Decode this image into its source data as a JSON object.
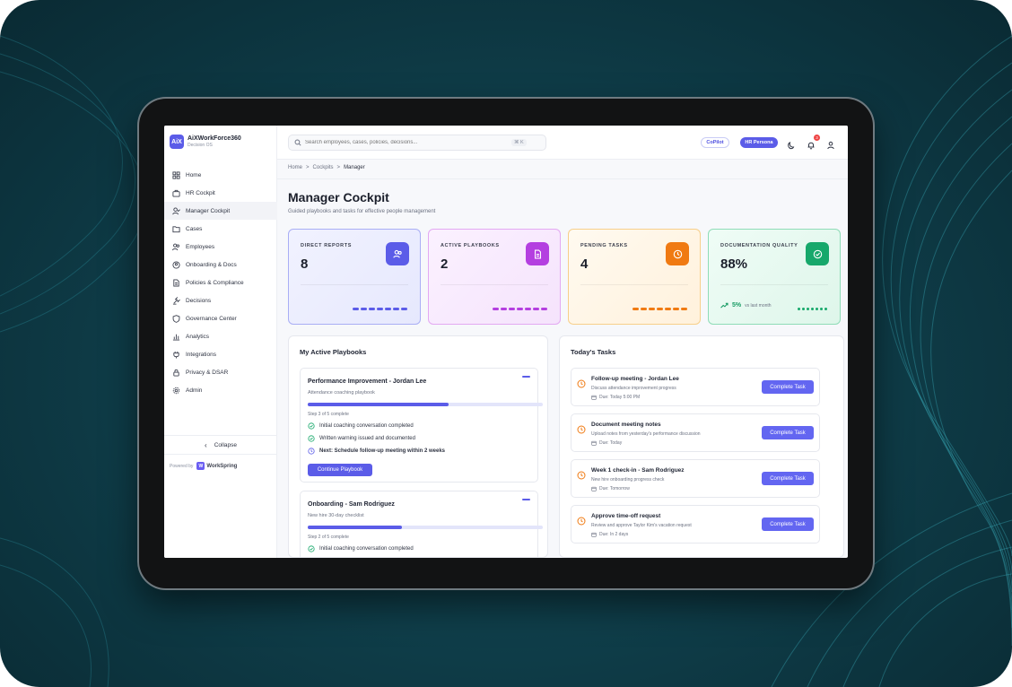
{
  "brand": {
    "logo": "AiX",
    "name": "AiXWorkForce360",
    "sub": "Decision OS"
  },
  "sidebar": {
    "items": [
      {
        "label": "Home",
        "icon": "home-icon"
      },
      {
        "label": "HR Cockpit",
        "icon": "briefcase-icon"
      },
      {
        "label": "Manager Cockpit",
        "icon": "user-check-icon",
        "active": true
      },
      {
        "label": "Cases",
        "icon": "folder-icon"
      },
      {
        "label": "Employees",
        "icon": "users-icon"
      },
      {
        "label": "Onboarding & Docs",
        "icon": "user-plus-icon"
      },
      {
        "label": "Policies & Compliance",
        "icon": "document-icon"
      },
      {
        "label": "Decisions",
        "icon": "gavel-icon"
      },
      {
        "label": "Governance Center",
        "icon": "shield-icon"
      },
      {
        "label": "Analytics",
        "icon": "bar-chart-icon"
      },
      {
        "label": "Integrations",
        "icon": "plug-icon"
      },
      {
        "label": "Privacy & DSAR",
        "icon": "lock-icon"
      },
      {
        "label": "Admin",
        "icon": "gear-icon"
      }
    ],
    "collapse_label": "Collapse",
    "powered_by": "Powered by",
    "powered_brand": "WorkSpring"
  },
  "header": {
    "search_placeholder": "Search employees, cases, policies, decisions...",
    "search_shortcut": "⌘ K",
    "copilot_label": "CoPilot",
    "persona_label": "HR Persona",
    "notification_count": "3"
  },
  "breadcrumb": [
    "Home",
    "Cockpits",
    "Manager"
  ],
  "page": {
    "title": "Manager Cockpit",
    "subtitle": "Guided playbooks and tasks for effective people management"
  },
  "stats": [
    {
      "label": "DIRECT REPORTS",
      "value": "8",
      "color": "#5b5ce8"
    },
    {
      "label": "ACTIVE PLAYBOOKS",
      "value": "2",
      "color": "#b43fe0"
    },
    {
      "label": "PENDING TASKS",
      "value": "4",
      "color": "#f07a12"
    },
    {
      "label": "DOCUMENTATION QUALITY",
      "value": "88%",
      "color": "#17a86b",
      "trend": "5%",
      "trend_note": "vs last month"
    }
  ],
  "playbooks": {
    "title": "My Active Playbooks",
    "items": [
      {
        "name": "Performance Improvement - Jordan Lee",
        "subtitle": "Attendance coaching playbook",
        "progress": 0.6,
        "step": "Step 3 of 5 complete",
        "checks": [
          "Initial coaching conversation completed",
          "Written warning issued and documented",
          "Next: Schedule follow-up meeting within 2 weeks"
        ],
        "button": "Continue Playbook"
      },
      {
        "name": "Onboarding - Sam Rodriguez",
        "subtitle": "New hire 30-day checklist",
        "progress": 0.4,
        "step": "Step 2 of 5 complete",
        "checks": [
          "Initial coaching conversation completed"
        ]
      }
    ]
  },
  "tasks": {
    "title": "Today's Tasks",
    "button_label": "Complete Task",
    "items": [
      {
        "title": "Follow-up meeting - Jordan Lee",
        "desc": "Discuss attendance improvement progress",
        "due": "Due: Today 5:00 PM"
      },
      {
        "title": "Document meeting notes",
        "desc": "Upload notes from yesterday's performance discussion",
        "due": "Due: Today"
      },
      {
        "title": "Week 1 check-in - Sam Rodriguez",
        "desc": "New hire onboarding progress check",
        "due": "Due: Tomorrow"
      },
      {
        "title": "Approve time-off request",
        "desc": "Review and approve Taylor Kim's vacation request",
        "due": "Due: In 2 days"
      }
    ]
  }
}
